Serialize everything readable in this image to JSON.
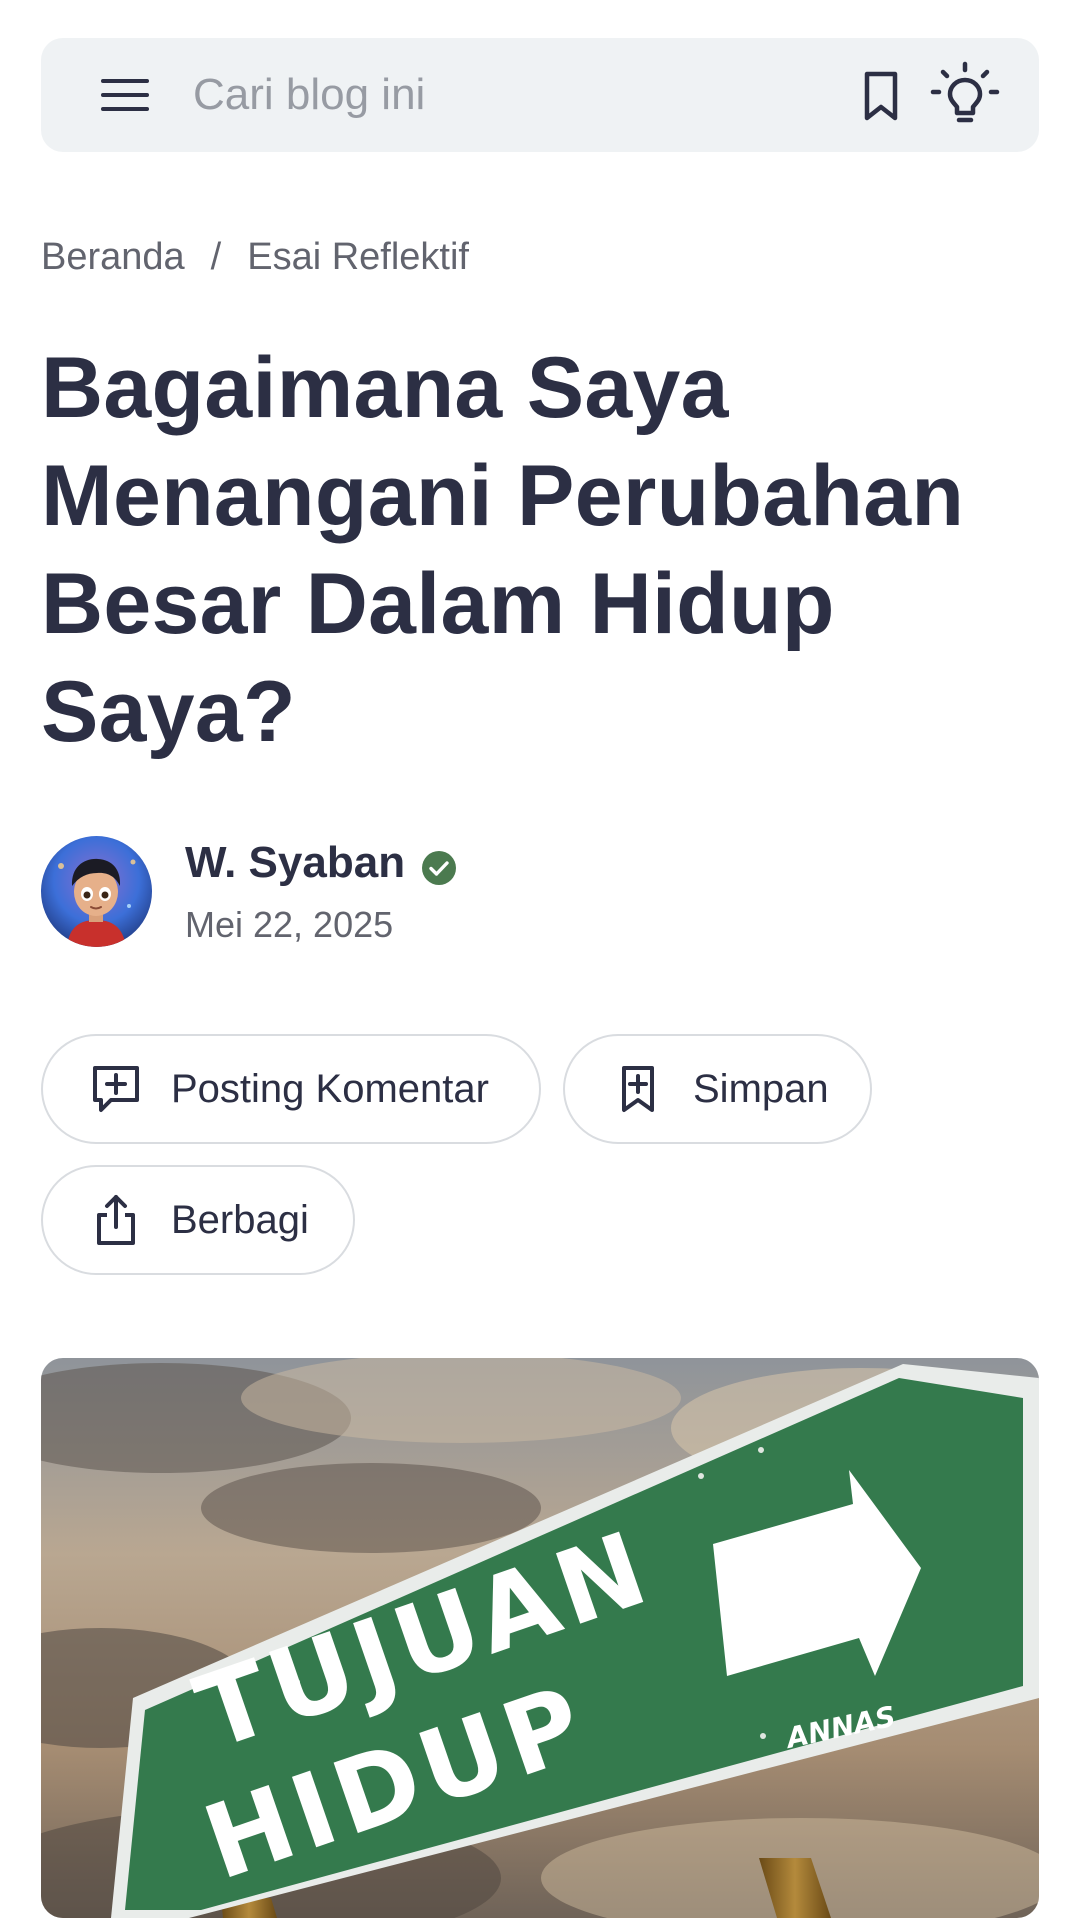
{
  "header": {
    "search_placeholder": "Cari blog ini",
    "menu_icon": "hamburger-menu-icon",
    "bookmark_icon": "bookmark-icon",
    "theme_icon": "lightbulb-icon"
  },
  "breadcrumb": {
    "home": "Beranda",
    "separator": "/",
    "category": "Esai Reflektif"
  },
  "post": {
    "title": "Bagaimana Saya Menangani Perubahan Besar Dalam Hidup Saya?",
    "author": "W. Syaban",
    "date": "Mei 22, 2025",
    "verified_color": "#4b7a4f"
  },
  "actions": {
    "comment_label": "Posting Komentar",
    "save_label": "Simpan",
    "share_label": "Berbagi"
  },
  "hero_image": {
    "sign_line1": "TUJUAN",
    "sign_line2": "HIDUP",
    "sign_watermark": "ANNAS",
    "sign_color": "#347a4d"
  },
  "colors": {
    "text": "#2c2f44",
    "muted": "#62646e",
    "topbar_bg": "#eff2f4",
    "border": "#d9dce0"
  }
}
